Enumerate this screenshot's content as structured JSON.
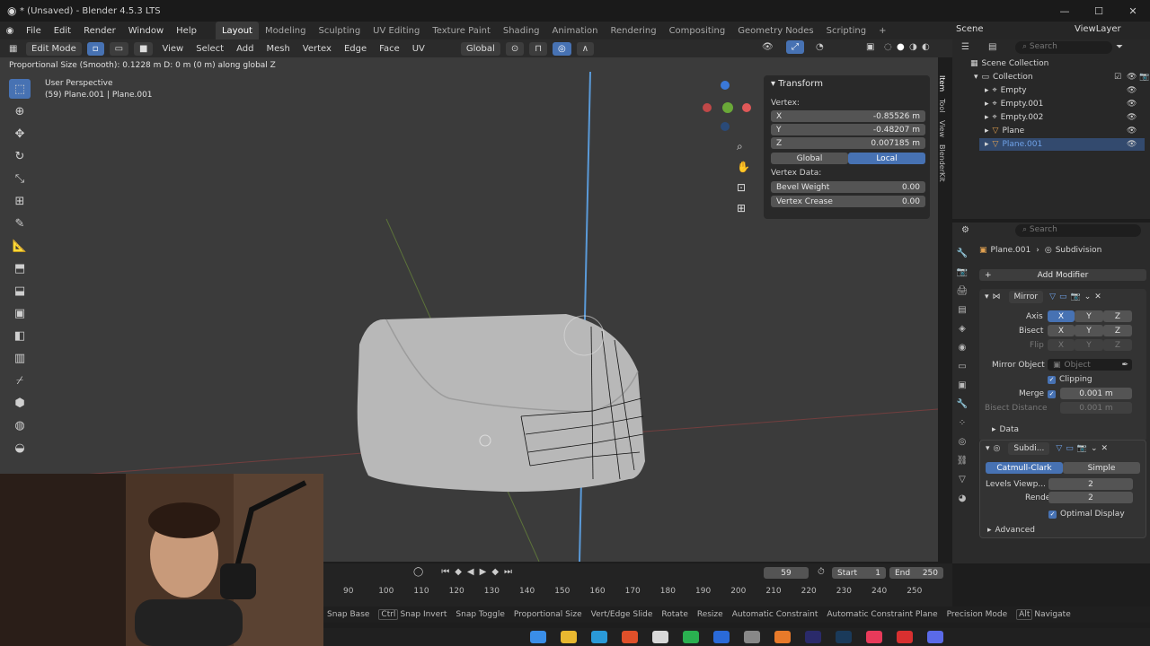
{
  "window": {
    "title": "* (Unsaved) - Blender 4.5.3 LTS"
  },
  "menu": {
    "items": [
      "File",
      "Edit",
      "Render",
      "Window",
      "Help"
    ],
    "workspaces": [
      "Layout",
      "Modeling",
      "Sculpting",
      "UV Editing",
      "Texture Paint",
      "Shading",
      "Animation",
      "Rendering",
      "Compositing",
      "Geometry Nodes",
      "Scripting"
    ],
    "scene": "Scene",
    "viewlayer": "ViewLayer"
  },
  "viewport_header": {
    "mode": "Edit Mode",
    "items": [
      "View",
      "Select",
      "Add",
      "Mesh",
      "Vertex",
      "Edge",
      "Face",
      "UV"
    ],
    "orientation": "Global"
  },
  "viewport": {
    "operator_text": "Proportional Size (Smooth): 0.1228 m  D: 0 m (0 m) along global Z",
    "view_name": "User Perspective",
    "object_info": "(59) Plane.001 | Plane.001"
  },
  "npanel": {
    "section": "Transform",
    "vertex_label": "Vertex:",
    "x_label": "X",
    "x_value": "-0.85526 m",
    "y_label": "Y",
    "y_value": "-0.48207 m",
    "z_label": "Z",
    "z_value": "0.007185 m",
    "global": "Global",
    "local": "Local",
    "vertex_data": "Vertex Data:",
    "bevel_label": "Bevel Weight",
    "bevel_value": "0.00",
    "crease_label": "Vertex Crease",
    "crease_value": "0.00",
    "tabs": [
      "Item",
      "Tool",
      "View",
      "BlenderKit"
    ]
  },
  "outliner": {
    "search_placeholder": "Search",
    "root": "Scene Collection",
    "collection": "Collection",
    "items": [
      "Empty",
      "Empty.001",
      "Empty.002",
      "Plane",
      "Plane.001"
    ]
  },
  "properties": {
    "search_placeholder": "Search",
    "object": "Plane.001",
    "modifier_crumb": "Subdivision",
    "add_modifier": "Add Modifier",
    "mirror": {
      "name": "Mirror",
      "axis_label": "Axis",
      "bisect_label": "Bisect",
      "flip_label": "Flip",
      "x": "X",
      "y": "Y",
      "z": "Z",
      "mirror_object_label": "Mirror Object",
      "mirror_object_placeholder": "Object",
      "clipping": "Clipping",
      "merge_label": "Merge",
      "merge_value": "0.001 m",
      "bisect_distance_label": "Bisect Distance",
      "bisect_distance_value": "0.001 m",
      "data": "Data"
    },
    "subdiv": {
      "name": "Subdi...",
      "catmull": "Catmull-Clark",
      "simple": "Simple",
      "levels_label": "Levels Viewp...",
      "levels_value": "2",
      "render_label": "Render",
      "render_value": "2",
      "optimal": "Optimal Display",
      "advanced": "Advanced"
    }
  },
  "timeline": {
    "frame": "59",
    "start_label": "Start",
    "start_value": "1",
    "end_label": "End",
    "end_value": "250",
    "ticks": [
      "90",
      "100",
      "110",
      "120",
      "130",
      "140",
      "150",
      "160",
      "170",
      "180",
      "190",
      "200",
      "210",
      "220",
      "230",
      "240",
      "250"
    ]
  },
  "statusbar": {
    "items": [
      "Snap Base",
      "Snap Invert",
      "Snap Toggle",
      "Proportional Size",
      "Vert/Edge Slide",
      "Rotate",
      "Resize",
      "Automatic Constraint",
      "Automatic Constraint Plane",
      "Precision Mode",
      "Navigate"
    ],
    "keys": [
      "Ctrl",
      "Alt"
    ]
  },
  "colors": {
    "accent": "#4772b3",
    "bg": "#3b3b3b"
  }
}
